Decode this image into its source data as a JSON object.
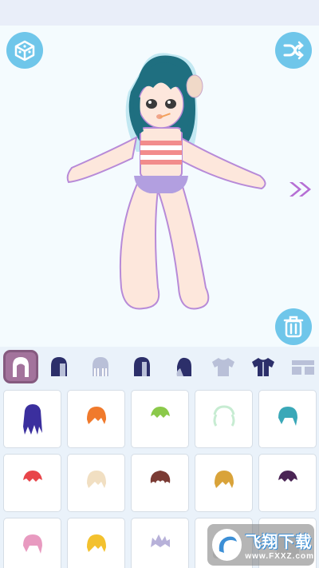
{
  "colors": {
    "accent": "#6fc6ea",
    "active_tab": "#a3739c",
    "icon_navy": "#2c2f6a",
    "stage_bg": "#f4fbfe",
    "panel_bg": "#eaf2fa"
  },
  "toolbar": {
    "random_icon": "dice-icon",
    "shuffle_icon": "shuffle-icon",
    "delete_icon": "trash-icon",
    "next_icon": "double-chevron-right-icon"
  },
  "tabs": [
    {
      "icon": "hair-front-icon",
      "active": true
    },
    {
      "icon": "hair-back-icon",
      "active": false
    },
    {
      "icon": "bangs-icon",
      "active": false
    },
    {
      "icon": "side-hair-icon",
      "active": false
    },
    {
      "icon": "hair-profile-icon",
      "active": false
    },
    {
      "icon": "tshirt-light-icon",
      "active": false
    },
    {
      "icon": "tshirt-dark-icon",
      "active": false
    },
    {
      "icon": "pants-icon",
      "active": false
    }
  ],
  "items": [
    {
      "color": "#3b2f9e",
      "style": "long"
    },
    {
      "color": "#f07a2c",
      "style": "bob"
    },
    {
      "color": "#8bc94a",
      "style": "short"
    },
    {
      "color": "#c7ecd2",
      "style": "twin"
    },
    {
      "color": "#3aa8b8",
      "style": "side"
    },
    {
      "color": "#e8454a",
      "style": "short"
    },
    {
      "color": "#f1dfc2",
      "style": "bob"
    },
    {
      "color": "#7b3b34",
      "style": "curly"
    },
    {
      "color": "#d9a33a",
      "style": "bob"
    },
    {
      "color": "#4a2454",
      "style": "short"
    },
    {
      "color": "#e89ac0",
      "style": "side"
    },
    {
      "color": "#f3c12e",
      "style": "bob"
    },
    {
      "color": "#b7b1d9",
      "style": "spiky"
    },
    {
      "color": "#e0e0e0",
      "style": "locked"
    },
    {
      "color": "#e0e0e0",
      "style": "locked"
    }
  ],
  "watermark": {
    "main": "飞翔下载",
    "sub": "www.FXXZ.com"
  }
}
